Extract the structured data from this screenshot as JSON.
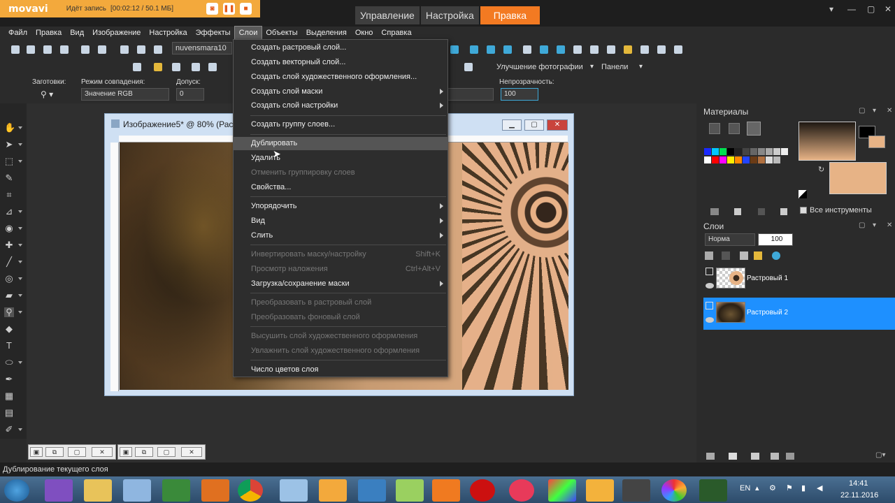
{
  "recorder": {
    "logo": "movavi",
    "status": "Идёт запись",
    "time": "[00:02:12 / 50.1 МБ]"
  },
  "modes": [
    "Управление",
    "Настройка",
    "Правка"
  ],
  "menubar": [
    "Файл",
    "Правка",
    "Вид",
    "Изображение",
    "Настройка",
    "Эффекты",
    "Слои",
    "Объекты",
    "Выделения",
    "Окно",
    "Справка"
  ],
  "toolbar1": {
    "preset_name": "nuvensmara10"
  },
  "toolbar2": {
    "enhance_label": "Улучшение фотографии",
    "panels_label": "Панели"
  },
  "options": {
    "presets_label": "Заготовки:",
    "match_mode_label": "Режим совпадения:",
    "match_mode_value": "Значение RGB",
    "tolerance_label": "Допуск:",
    "tolerance_value": "0",
    "opacity_label": "Непрозрачность:",
    "opacity_value": "100"
  },
  "image_window": {
    "title": "Изображение5* @  80% (Рас"
  },
  "context_menu": [
    {
      "label": "Создать растровый слой...",
      "state": "normal"
    },
    {
      "label": "Создать векторный слой...",
      "state": "normal"
    },
    {
      "label": "Создать слой художественного оформления...",
      "state": "normal"
    },
    {
      "label": "Создать слой маски",
      "state": "normal",
      "submenu": true
    },
    {
      "label": "Создать слой настройки",
      "state": "normal",
      "submenu": true
    },
    {
      "label": "Создать группу слоев...",
      "state": "normal"
    },
    {
      "label": "Дублировать",
      "state": "highlight"
    },
    {
      "label": "Удалить",
      "state": "normal"
    },
    {
      "label": "Отменить группировку слоев",
      "state": "disabled"
    },
    {
      "label": "Свойства...",
      "state": "normal"
    },
    {
      "label": "Упорядочить",
      "state": "normal",
      "submenu": true
    },
    {
      "label": "Вид",
      "state": "normal",
      "submenu": true
    },
    {
      "label": "Слить",
      "state": "normal",
      "submenu": true
    },
    {
      "label": "Инвертировать маску/настройку",
      "state": "disabled",
      "shortcut": "Shift+K"
    },
    {
      "label": "Просмотр наложения",
      "state": "disabled",
      "shortcut": "Ctrl+Alt+V"
    },
    {
      "label": "Загрузка/сохранение маски",
      "state": "normal",
      "submenu": true
    },
    {
      "label": "Преобразовать в растровый слой",
      "state": "disabled"
    },
    {
      "label": "Преобразовать фоновый слой",
      "state": "disabled"
    },
    {
      "label": "Высушить слой художественного оформления",
      "state": "disabled"
    },
    {
      "label": "Увлажнить слой художественного оформления",
      "state": "disabled"
    },
    {
      "label": "Число цветов слоя",
      "state": "normal"
    }
  ],
  "materials": {
    "title": "Материалы",
    "all_tools_label": "Все инструменты"
  },
  "layers": {
    "title": "Слои",
    "blend_mode": "Норма",
    "opacity": "100",
    "items": [
      {
        "name": "Растровый 1",
        "selected": false
      },
      {
        "name": "Растровый 2",
        "selected": true
      }
    ]
  },
  "status_text": "Дублирование текущего слоя",
  "tray": {
    "lang": "EN",
    "time": "14:41",
    "date": "22.11.2016"
  },
  "colors": {
    "accent_orange": "#f37a22",
    "recorder_bg": "#f3a93c",
    "layer_selected": "#1e90ff"
  }
}
